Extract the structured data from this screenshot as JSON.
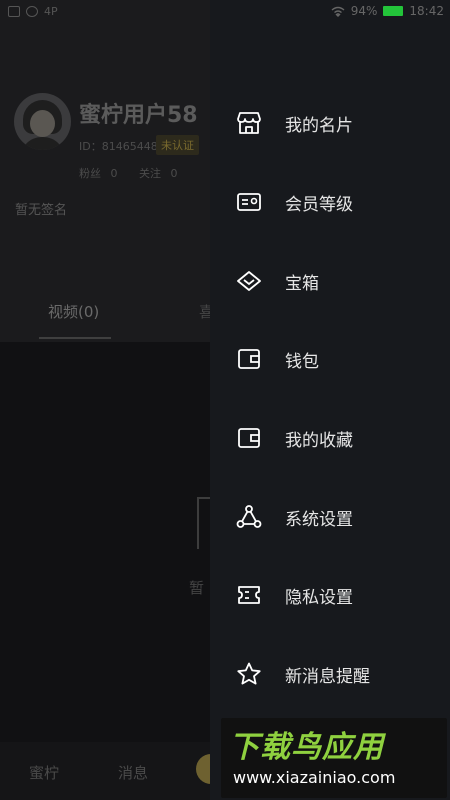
{
  "status_bar": {
    "left_text": "4P",
    "battery_text": "94%",
    "time": "18:42"
  },
  "profile": {
    "username": "蜜柠用户58",
    "id_text": "ID：81465448",
    "badge": "未认证",
    "fans_label": "粉丝",
    "fans_count": "0",
    "follow_label": "关注",
    "follow_count": "0",
    "bio": "暂无签名",
    "tab_video": "视频(0)",
    "tab_other": "喜",
    "empty_text": "暂"
  },
  "bottom_nav": {
    "items": [
      {
        "label": "蜜柠"
      },
      {
        "label": "消息"
      }
    ]
  },
  "drawer": {
    "items": [
      {
        "label": "我的名片",
        "icon": "store-icon"
      },
      {
        "label": "会员等级",
        "icon": "member-card-icon"
      },
      {
        "label": "宝箱",
        "icon": "diamond-icon"
      },
      {
        "label": "钱包",
        "icon": "wallet-icon"
      },
      {
        "label": "我的收藏",
        "icon": "favorites-icon"
      },
      {
        "label": "系统设置",
        "icon": "settings-nodes-icon"
      },
      {
        "label": "隐私设置",
        "icon": "privacy-ticket-icon"
      },
      {
        "label": "新消息提醒",
        "icon": "star-icon"
      }
    ]
  },
  "watermark": {
    "logo": "下载鸟应用",
    "url": "www.xiazainiao.com"
  },
  "colors": {
    "drawer_bg": "#17191d",
    "battery": "#23c43a",
    "watermark_green": "#8fd13f"
  }
}
